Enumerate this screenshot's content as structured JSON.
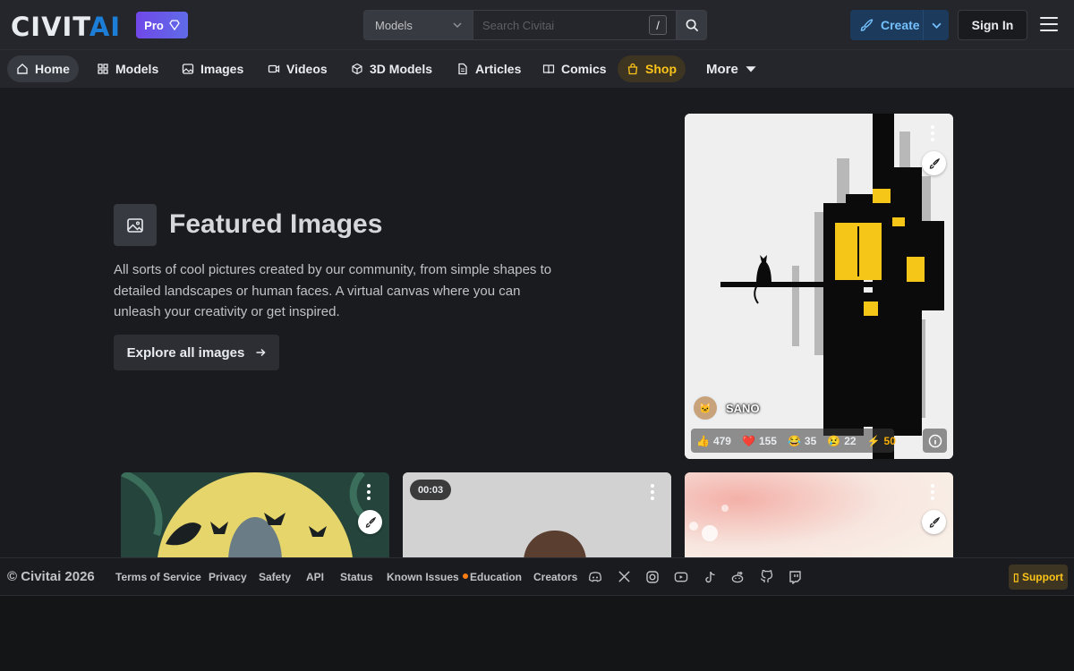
{
  "header": {
    "logo_main": "CIVIT",
    "logo_accent": "AI",
    "pro_label": "Pro",
    "search_category": "Models",
    "search_placeholder": "Search Civitai",
    "search_shortcut": "/",
    "create_label": "Create",
    "signin_label": "Sign In"
  },
  "nav": {
    "items": [
      {
        "label": "Home",
        "icon": "home-icon"
      },
      {
        "label": "Models",
        "icon": "grid-icon"
      },
      {
        "label": "Images",
        "icon": "photo-icon"
      },
      {
        "label": "Videos",
        "icon": "video-icon"
      },
      {
        "label": "3D Models",
        "icon": "cube-icon"
      },
      {
        "label": "Articles",
        "icon": "file-text-icon"
      },
      {
        "label": "Comics",
        "icon": "book-icon"
      },
      {
        "label": "Shop",
        "icon": "shopping-bag-icon"
      }
    ],
    "more_label": "More"
  },
  "hero": {
    "title": "Featured Images",
    "description": "All sorts of cool pictures created by our community, from simple shapes to detailed landscapes or human faces. A virtual canvas where you can unleash your creativity or get inspired.",
    "button_label": "Explore all images"
  },
  "featured_card": {
    "author": "SANO",
    "reactions": {
      "like": "479",
      "heart": "155",
      "laugh": "35",
      "cry": "22",
      "buzz": "50"
    }
  },
  "video_card": {
    "duration": "00:03"
  },
  "footer": {
    "copyright": "© Civitai 2026",
    "links": [
      "Terms of Service",
      "Privacy",
      "Safety",
      "API",
      "Status",
      "Known Issues",
      "Education",
      "Creators"
    ],
    "support_label": "Support"
  },
  "colors": {
    "accent_blue": "#1c7ed6",
    "pro_purple": "#7048e8",
    "shop_gold": "#fcc419",
    "background": "#1a1b1e"
  }
}
